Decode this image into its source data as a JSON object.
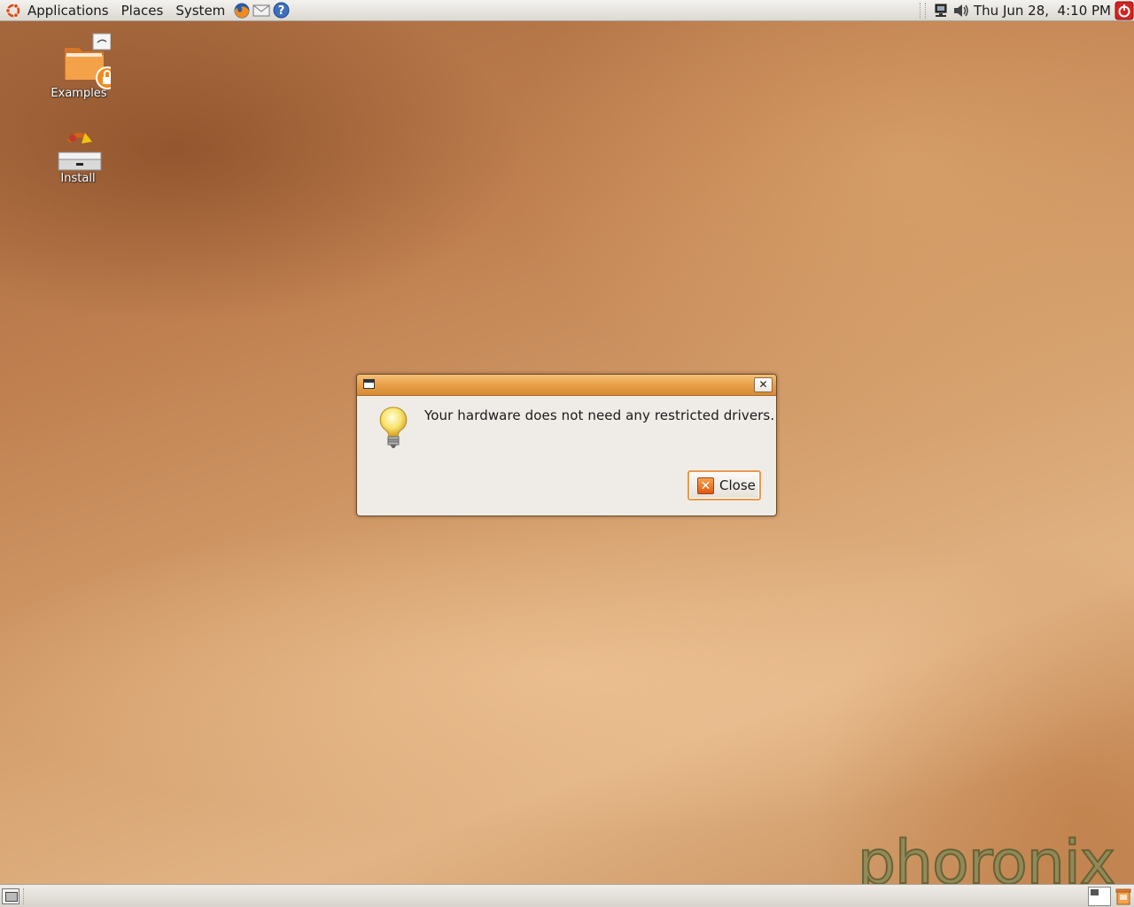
{
  "top_panel": {
    "menus": [
      "Applications",
      "Places",
      "System"
    ],
    "launchers": [
      "firefox-icon",
      "mail-icon",
      "help-icon"
    ],
    "clock": "Thu Jun 28,  4:10 PM"
  },
  "desktop": {
    "icons": [
      {
        "label": "Examples",
        "icon": "folder-locked-icon"
      },
      {
        "label": "Install",
        "icon": "install-drive-icon"
      }
    ]
  },
  "dialog": {
    "message": "Your hardware does not need any restricted drivers.",
    "close_button": "Close",
    "icon": "lightbulb-icon"
  },
  "watermark": "phoronix",
  "colors": {
    "titlebar": "#e8a049",
    "button_focus": "#e89a4c",
    "desktop": "#c08050"
  }
}
